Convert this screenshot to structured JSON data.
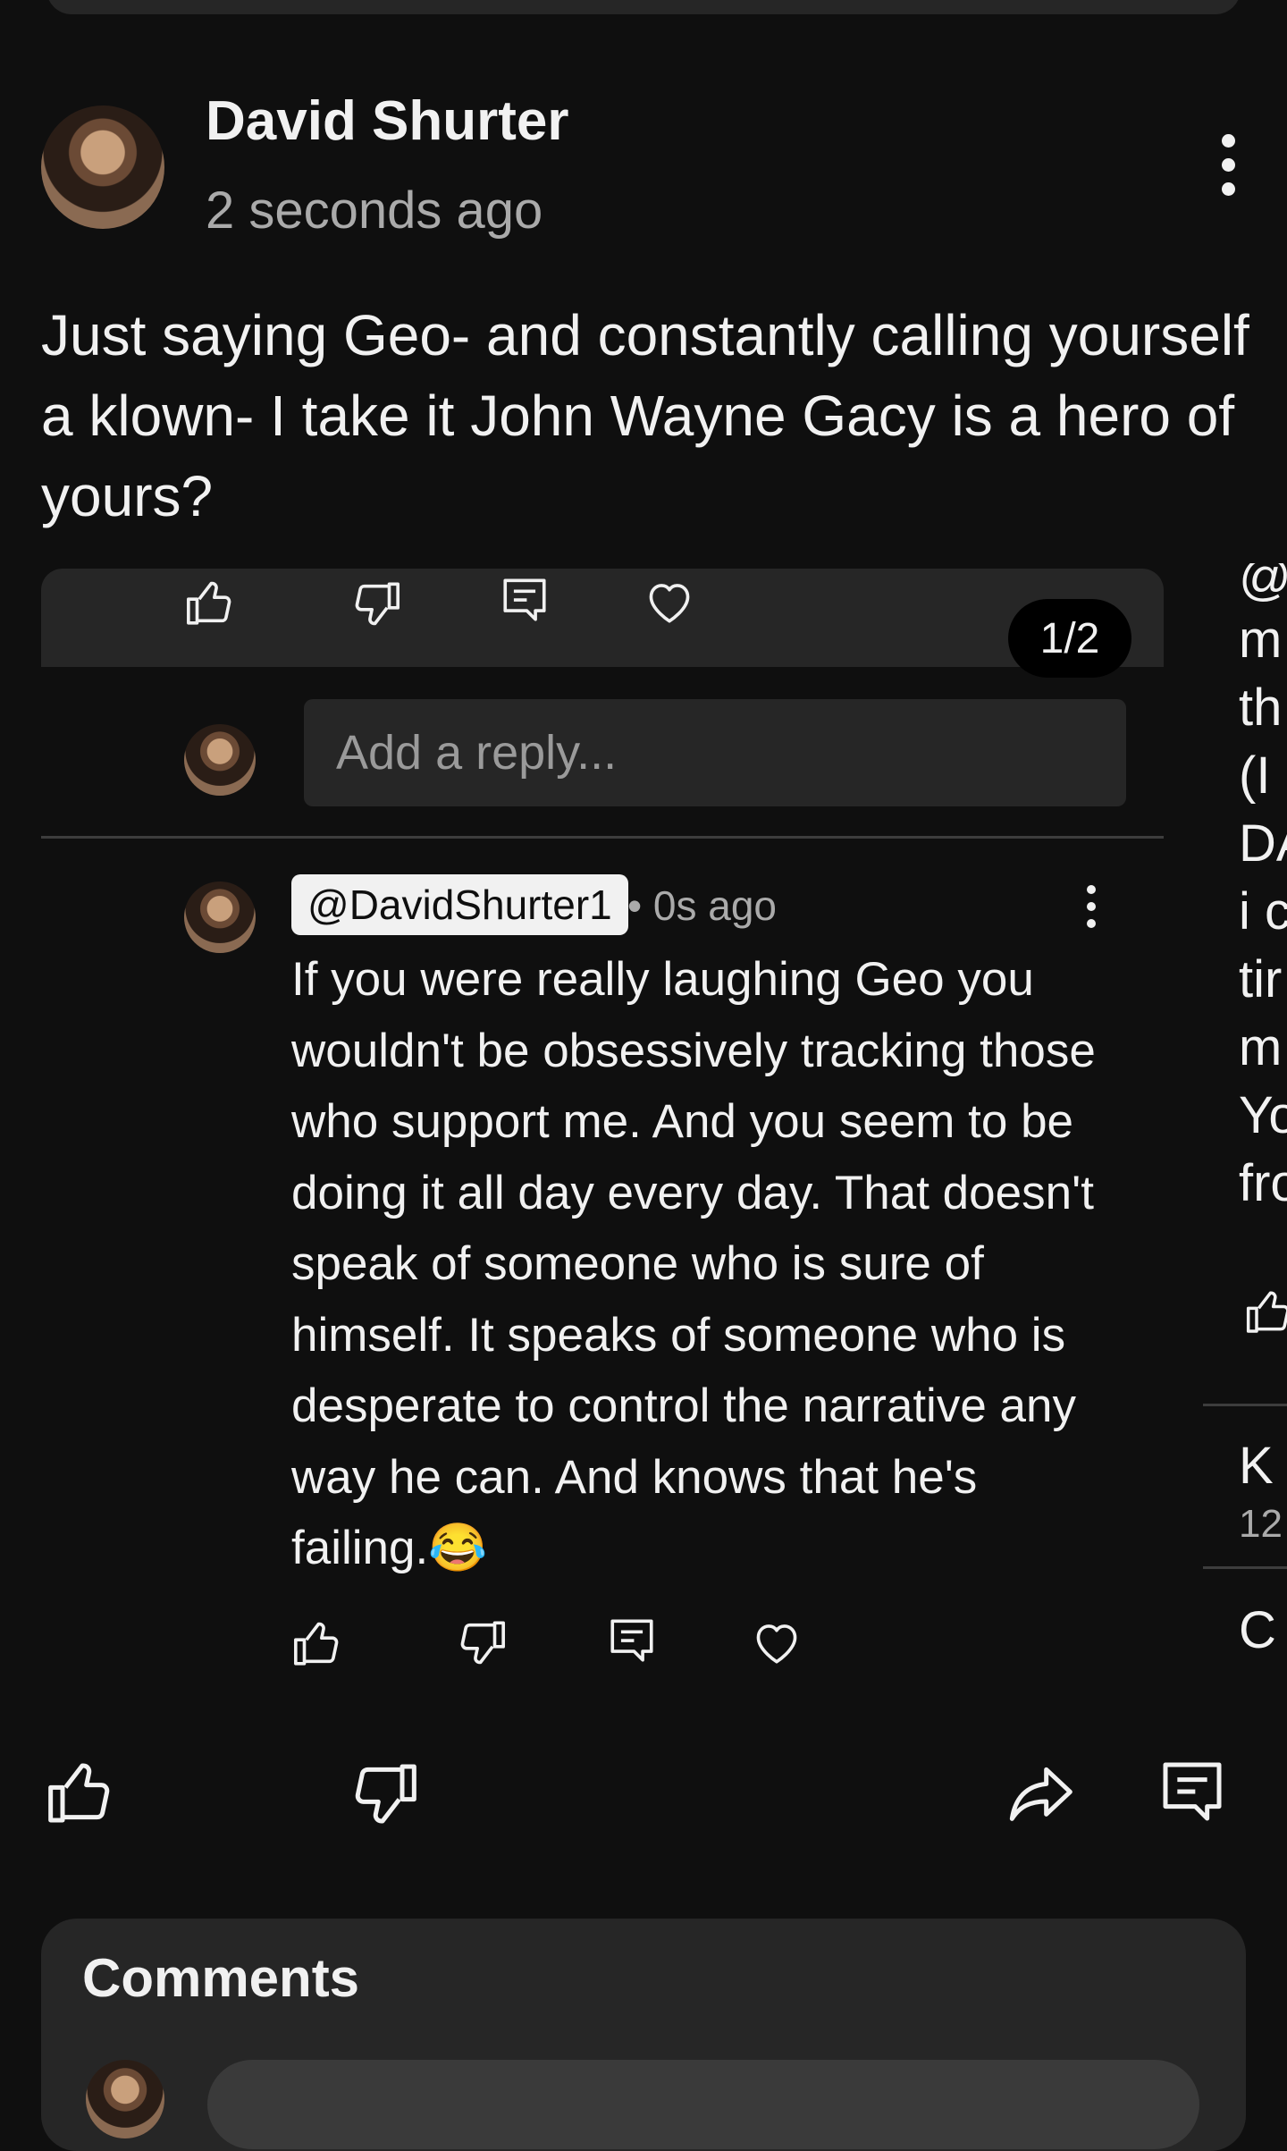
{
  "post": {
    "author": "David Shurter",
    "timestamp": "2 seconds ago",
    "text": "Just saying Geo- and constantly calling yourself a klown- I take it John Wayne Gacy is a hero of yours?"
  },
  "screenshot": {
    "pager": "1/2",
    "reply_placeholder": "Add a reply...",
    "reply": {
      "handle": "@DavidShurter1",
      "meta": "• 0s ago",
      "text": "If you were really laughing Geo you wouldn't be obsessively tracking those who support me. And you seem to be doing it all day every day. That doesn't speak of someone who is sure of himself. It speaks of someone who is desperate to control the narrative any way he can. And knows that he's failing.😂"
    }
  },
  "side_fragments": [
    "@",
    "m",
    "th",
    "(I",
    "DA",
    "i c",
    "tir",
    "m",
    "Yo",
    "fro",
    "K",
    "12",
    "C"
  ],
  "comments": {
    "title": "Comments"
  },
  "icons": {
    "like": "thumb-up-icon",
    "dislike": "thumb-down-icon",
    "reply": "comment-icon",
    "heart": "heart-icon",
    "share": "share-icon"
  }
}
